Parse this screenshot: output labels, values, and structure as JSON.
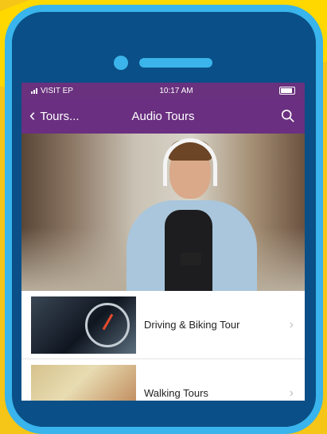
{
  "status_bar": {
    "carrier": "VISIT EP",
    "time": "10:17 AM"
  },
  "nav": {
    "back_label": "Tours...",
    "title": "Audio Tours"
  },
  "tours": [
    {
      "label": "Driving & Biking Tour"
    },
    {
      "label": "Walking Tours"
    }
  ],
  "icons": {
    "back": "chevron-left-icon",
    "search": "search-icon",
    "row": "chevron-right-icon"
  },
  "colors": {
    "nav": "#6a2f80",
    "phone_frame": "#39b4ec",
    "phone_body": "#0a4f87",
    "background": "#f5c518"
  }
}
